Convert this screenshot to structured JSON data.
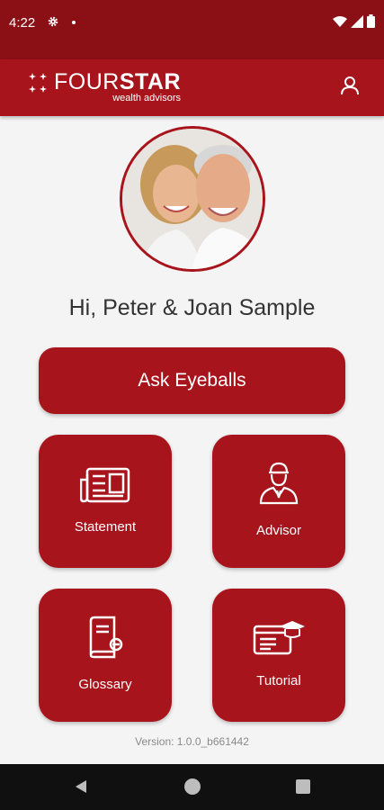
{
  "status_bar": {
    "time": "4:22"
  },
  "app_bar": {
    "logo_part1": "FOUR",
    "logo_part2": "STAR",
    "logo_sub": "wealth advisors"
  },
  "greeting": "Hi, Peter & Joan Sample",
  "primary_action": {
    "label": "Ask Eyeballs"
  },
  "tiles": [
    {
      "label": "Statement",
      "icon": "newspaper-icon"
    },
    {
      "label": "Advisor",
      "icon": "advisor-person-icon"
    },
    {
      "label": "Glossary",
      "icon": "book-icon"
    },
    {
      "label": "Tutorial",
      "icon": "graduation-cap-screen-icon"
    }
  ],
  "version": "Version: 1.0.0_b661442",
  "colors": {
    "brand_red": "#a8141c",
    "status_bar": "#8b1016",
    "background": "#f4f4f4"
  }
}
